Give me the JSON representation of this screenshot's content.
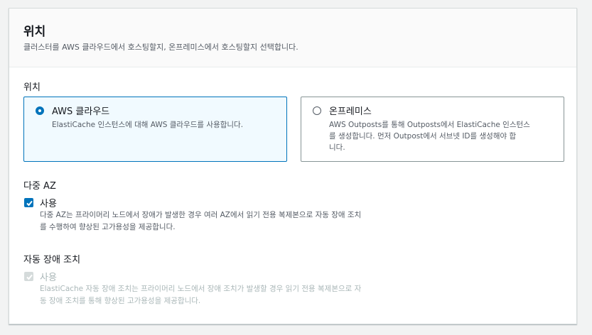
{
  "header": {
    "title": "위치",
    "description": "클러스터를 AWS 클라우드에서 호스팅할지, 온프레미스에서 호스팅할지 선택합니다."
  },
  "location_field": {
    "label": "위치",
    "options": [
      {
        "title": "AWS 클라우드",
        "description": "ElastiCache 인스턴스에 대해 AWS 클라우드를 사용합니다.",
        "selected": true
      },
      {
        "title": "온프레미스",
        "description_lines": [
          "AWS Outposts를 통해 Outposts에서 ElastiCache 인스턴스",
          "를 생성합니다. 먼저 Outpost에서 서브넷 ID를 생성해야 합",
          "니다."
        ],
        "selected": false
      }
    ]
  },
  "multi_az": {
    "label": "다중 AZ",
    "checkbox_label": "사용",
    "checked": true,
    "description_lines": [
      "다중 AZ는 프라이머리 노드에서 장애가 발생한 경우 여러 AZ에서 읽기 전용 복제본으로 자동 장애 조치",
      "를 수행하여 향상된 고가용성을 제공합니다."
    ]
  },
  "auto_failover": {
    "label": "자동 장애 조치",
    "checkbox_label": "사용",
    "checked": true,
    "disabled": true,
    "description_lines": [
      "ElastiCache 자동 장애 조치는 프라이머리 노드에서 장애 조치가 발생할 경우 읽기 전용 복제본으로 자",
      "동 장애 조치를 통해 향상된 고가용성을 제공합니다."
    ]
  },
  "colors": {
    "accent": "#0073bb",
    "selected_bg": "#f1faff",
    "disabled": "#aab7b8"
  }
}
